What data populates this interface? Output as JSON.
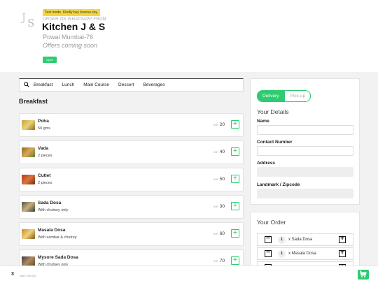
{
  "header": {
    "test_badge": "Test mode. Kindly buy license key.",
    "order_whatsapp": "ORDER ON WHATSAPP FROM",
    "title": "Kitchen J & S",
    "locality": "Powai Mumbai-76",
    "offers": "Offers coming soon",
    "status": "Open"
  },
  "categories": [
    "Breakfast",
    "Lunch",
    "Main Course",
    "Dessert",
    "Beverages"
  ],
  "section_title": "Breakfast",
  "items": [
    {
      "name": "Poha",
      "desc": "50 gms",
      "currency": "INR",
      "price": "20"
    },
    {
      "name": "Vada",
      "desc": "2 pieces",
      "currency": "INR",
      "price": "40"
    },
    {
      "name": "Cutlet",
      "desc": "2 pieces",
      "currency": "INR",
      "price": "50"
    },
    {
      "name": "Sada Dosa",
      "desc": "With chutney only",
      "currency": "INR",
      "price": "30"
    },
    {
      "name": "Masala Dosa",
      "desc": "With sambar & chutrey",
      "currency": "INR",
      "price": "60"
    },
    {
      "name": "Mysore Sada Dosa",
      "desc": "With chutney only",
      "currency": "INR",
      "price": "70"
    }
  ],
  "details": {
    "delivery": "Delivery",
    "pickup": "Pick-up",
    "title": "Your Details",
    "name_label": "Name",
    "contact_label": "Contact Number",
    "address_label": "Address",
    "landmark_label": "Landmark / Zipcode"
  },
  "order": {
    "title": "Your Order",
    "rows": [
      {
        "qty": "1",
        "name": "x Sada Dosa"
      },
      {
        "qty": "1",
        "name": "x Masala Dosa"
      }
    ]
  },
  "footer": {
    "count": "3",
    "total": "(INR 190.00)"
  },
  "colors": {
    "accent": "#2ecc71",
    "badge": "#f5d742"
  }
}
